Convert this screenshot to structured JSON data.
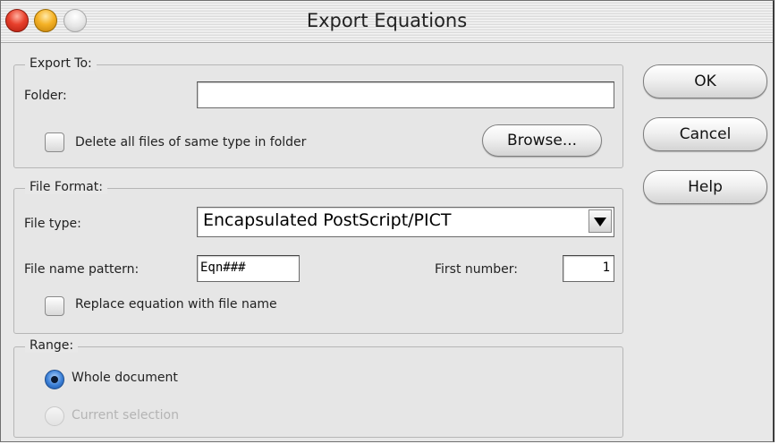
{
  "window": {
    "title": "Export Equations"
  },
  "export_to": {
    "legend": "Export To:",
    "folder_label": "Folder:",
    "folder_value": "",
    "delete_label": "Delete all files of same type in folder",
    "browse_label": "Browse..."
  },
  "file_format": {
    "legend": "File Format:",
    "file_type_label": "File type:",
    "file_type_value": "Encapsulated PostScript/PICT",
    "pattern_label": "File name pattern:",
    "pattern_value": "Eqn###",
    "first_number_label": "First number:",
    "first_number_value": "1",
    "replace_label": "Replace equation with file name"
  },
  "range": {
    "legend": "Range:",
    "whole_document_label": "Whole document",
    "current_selection_label": "Current selection",
    "selected": "Whole document"
  },
  "buttons": {
    "ok": "OK",
    "cancel": "Cancel",
    "help": "Help"
  }
}
